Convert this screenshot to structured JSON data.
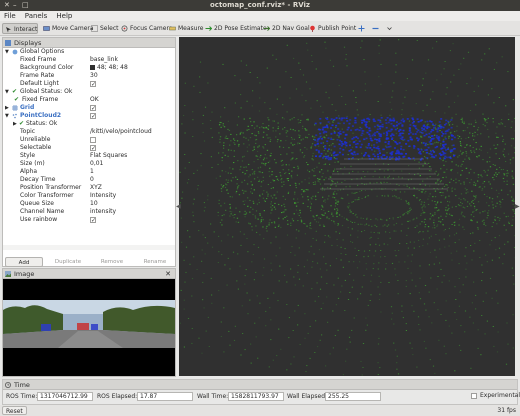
{
  "window": {
    "title": "octomap_conf.rviz* - RViz"
  },
  "menu": [
    "File",
    "Panels",
    "Help"
  ],
  "toolbar": {
    "tools": [
      "Interact",
      "Move Camera",
      "Select",
      "Focus Camera",
      "Measure",
      "2D Pose Estimate",
      "2D Nav Goal",
      "Publish Point"
    ],
    "active": "Interact"
  },
  "displays": {
    "title": "Displays",
    "rows": [
      {
        "label": "Global Options",
        "value": ""
      },
      {
        "label": "Fixed Frame",
        "value": "base_link"
      },
      {
        "label": "Background Color",
        "value": "48; 48; 48"
      },
      {
        "label": "Frame Rate",
        "value": "30"
      },
      {
        "label": "Default Light",
        "value": ""
      },
      {
        "label": "Global Status: Ok",
        "value": ""
      },
      {
        "label": "Fixed Frame",
        "value": "OK"
      },
      {
        "label": "Grid",
        "value": ""
      },
      {
        "label": "PointCloud2",
        "value": ""
      },
      {
        "label": "Status: Ok",
        "value": ""
      },
      {
        "label": "Topic",
        "value": "/kitti/velo/pointcloud"
      },
      {
        "label": "Unreliable",
        "value": ""
      },
      {
        "label": "Selectable",
        "value": ""
      },
      {
        "label": "Style",
        "value": "Flat Squares"
      },
      {
        "label": "Size (m)",
        "value": "0,01"
      },
      {
        "label": "Alpha",
        "value": "1"
      },
      {
        "label": "Decay Time",
        "value": "0"
      },
      {
        "label": "Position Transformer",
        "value": "XYZ"
      },
      {
        "label": "Color Transformer",
        "value": "Intensity"
      },
      {
        "label": "Queue Size",
        "value": "10"
      },
      {
        "label": "Channel Name",
        "value": "intensity"
      },
      {
        "label": "Use rainbow",
        "value": ""
      }
    ],
    "buttons": [
      "Add",
      "Duplicate",
      "Remove",
      "Rename"
    ]
  },
  "image_panel": {
    "title": "Image"
  },
  "time_panel": {
    "title": "Time",
    "ros_time_label": "ROS Time:",
    "ros_time": "1317046712.99",
    "ros_elapsed_label": "ROS Elapsed:",
    "ros_elapsed": "17.87",
    "wall_time_label": "Wall Time:",
    "wall_time": "1582811793.97",
    "wall_elapsed_label": "Wall Elapsed:",
    "wall_elapsed": "255.25",
    "experimental_label": "Experimental"
  },
  "status": {
    "reset": "Reset",
    "fps": "31 fps"
  },
  "colors": {
    "background_3d": "#303030",
    "accent": "#3a6fc2",
    "points_green": "#3fa632",
    "points_blue": "#1c2fd6"
  }
}
